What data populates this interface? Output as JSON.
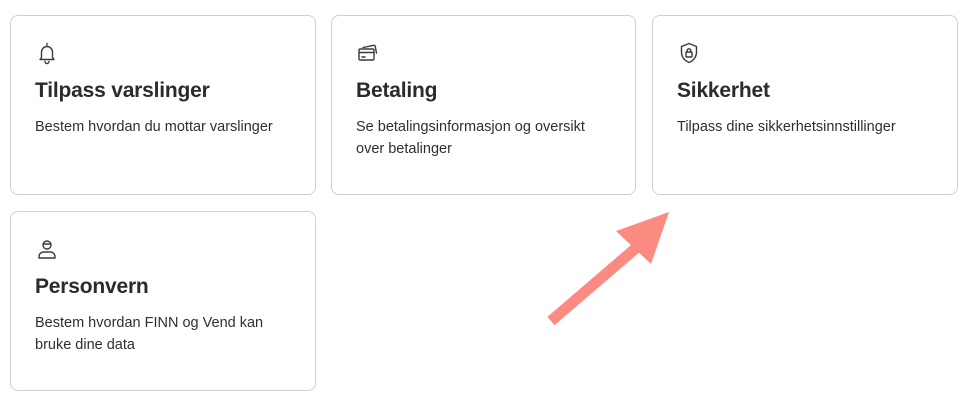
{
  "cards": [
    {
      "title": "Tilpass varslinger",
      "description": "Bestem hvordan du mottar varslinger",
      "icon": "bell-icon"
    },
    {
      "title": "Betaling",
      "description": "Se betalingsinformasjon og oversikt over betalinger",
      "icon": "credit-card-icon"
    },
    {
      "title": "Sikkerhet",
      "description": "Tilpass dine sikkerhetsinnstillinger",
      "icon": "shield-lock-icon"
    },
    {
      "title": "Personvern",
      "description": "Bestem hvordan FINN og Vend kan bruke dine data",
      "icon": "person-icon"
    }
  ],
  "colors": {
    "card_border": "#cfcfd3",
    "text": "#2b2b2f",
    "annotation_arrow": "#fb8a80"
  },
  "annotation": {
    "type": "arrow",
    "points_to": "Sikkerhet"
  }
}
